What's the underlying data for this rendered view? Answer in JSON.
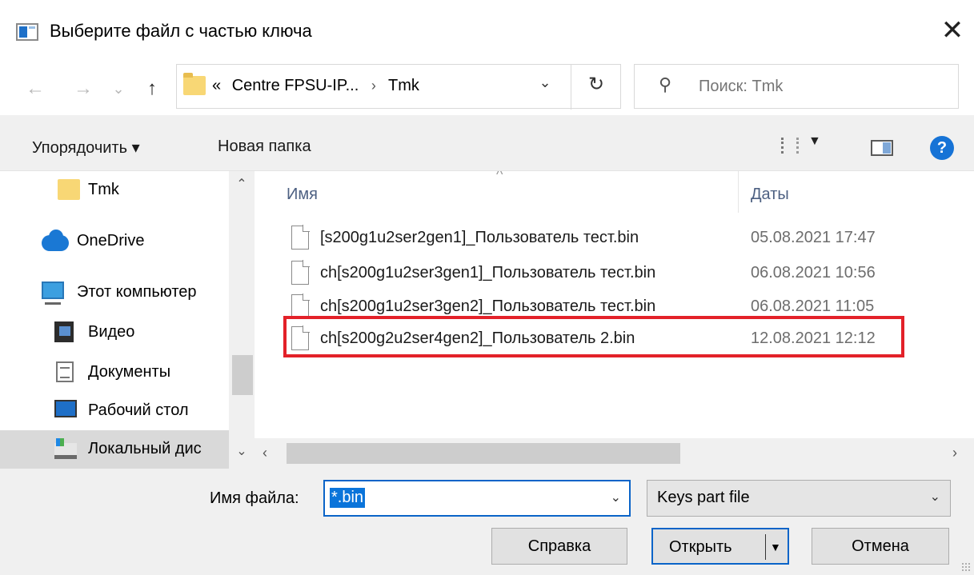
{
  "window": {
    "title": "Выберите файл с частью ключа",
    "close_glyph": "✕"
  },
  "nav": {
    "back_glyph": "←",
    "forward_glyph": "→",
    "recent_glyph": "⌄",
    "up_glyph": "↑",
    "address": {
      "overflow": "«",
      "crumbs": [
        "Centre FPSU-IP...",
        "Tmk"
      ],
      "separator": "›",
      "dropdown_glyph": "⌄",
      "refresh_glyph": "↻"
    },
    "search": {
      "placeholder": "Поиск: Tmk",
      "icon_glyph": "⚲"
    }
  },
  "toolbar": {
    "organize_label": "Упорядочить ▾",
    "new_folder_label": "Новая папка",
    "view_arrow": "▼",
    "help_glyph": "?"
  },
  "sidebar": {
    "items": [
      {
        "label": "Tmk",
        "icon": "folder-icon"
      },
      {
        "label": "OneDrive",
        "icon": "cloud-icon"
      },
      {
        "label": "Этот компьютер",
        "icon": "computer-icon"
      },
      {
        "label": "Видео",
        "icon": "video-icon"
      },
      {
        "label": "Документы",
        "icon": "documents-icon"
      },
      {
        "label": "Рабочий стол",
        "icon": "desktop-icon"
      },
      {
        "label": "Локальный дис",
        "icon": "disk-icon",
        "selected": true
      }
    ],
    "scroll_up_glyph": "⌃",
    "scroll_down_glyph": "⌄"
  },
  "files": {
    "sort_glyph": "^",
    "columns": [
      "Имя",
      "Даты"
    ],
    "rows": [
      {
        "name": "[s200g1u2ser2gen1]_Пользователь тест.bin",
        "date": "05.08.2021 17:47"
      },
      {
        "name": "ch[s200g1u2ser3gen1]_Пользователь тест.bin",
        "date": "06.08.2021 10:56"
      },
      {
        "name": "ch[s200g1u2ser3gen2]_Пользователь тест.bin",
        "date": "06.08.2021 11:05"
      },
      {
        "name": "ch[s200g2u2ser4gen2]_Пользователь 2.bin",
        "date": "12.08.2021 12:12",
        "highlighted": true
      }
    ],
    "hscroll_left": "‹",
    "hscroll_right": "›"
  },
  "footer": {
    "filename_label": "Имя файла:",
    "filename_value": "*.bin",
    "filter_value": "Keys part file",
    "dropdown_glyph": "⌄",
    "help_button": "Справка",
    "open_button": "Открыть",
    "open_arrow": "▼",
    "cancel_button": "Отмена"
  },
  "colors": {
    "highlight_border": "#e32129",
    "accent": "#0a64c8"
  }
}
